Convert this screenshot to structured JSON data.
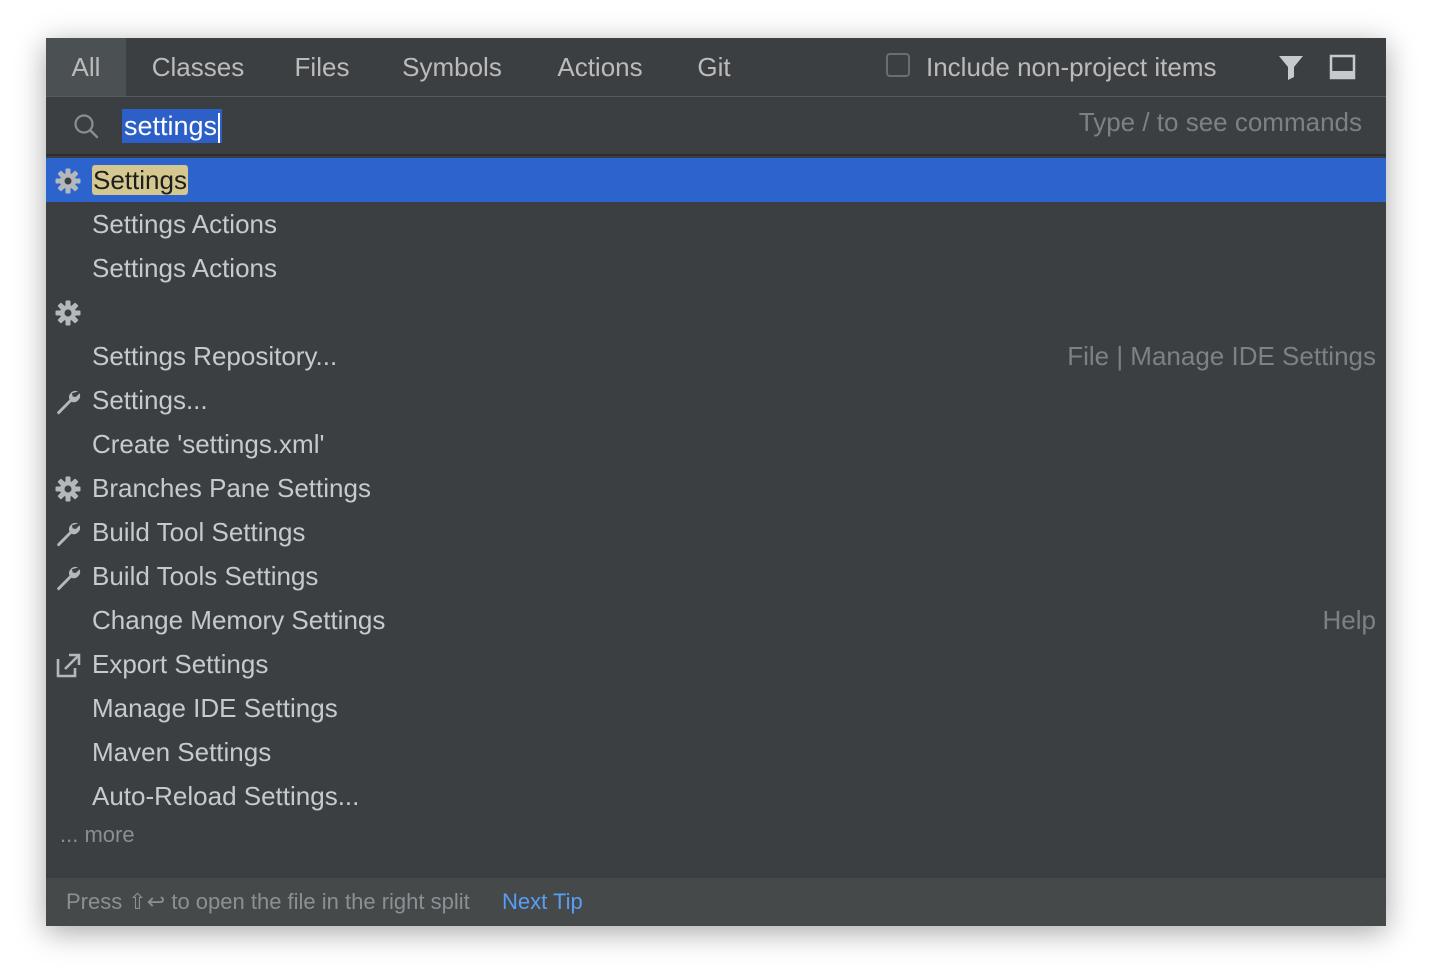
{
  "tabs": [
    {
      "label": "All",
      "active": true
    },
    {
      "label": "Classes",
      "active": false
    },
    {
      "label": "Files",
      "active": false
    },
    {
      "label": "Symbols",
      "active": false
    },
    {
      "label": "Actions",
      "active": false
    },
    {
      "label": "Git",
      "active": false
    }
  ],
  "options": {
    "include_label": "Include non-project items",
    "include_checked": false,
    "filter_icon": "filter-icon",
    "preview_icon": "preview-panel-icon"
  },
  "search": {
    "icon": "search-icon",
    "query": "settings",
    "hint": "Type / to see commands"
  },
  "results": [
    {
      "icon": "gear-icon",
      "label": "Settings",
      "location": "",
      "selected": true
    },
    {
      "icon": "",
      "label": "Settings Actions",
      "location": ""
    },
    {
      "icon": "",
      "label": "Settings Actions",
      "location": ""
    },
    {
      "icon": "gear-icon",
      "label": "",
      "location": ""
    },
    {
      "icon": "",
      "label": "Settings Repository...",
      "location": "File | Manage IDE Settings"
    },
    {
      "icon": "wrench-icon",
      "label": "Settings...",
      "location": ""
    },
    {
      "icon": "",
      "label": "Create 'settings.xml'",
      "location": ""
    },
    {
      "icon": "gear-icon",
      "label": "Branches Pane Settings",
      "location": ""
    },
    {
      "icon": "wrench-icon",
      "label": "Build Tool Settings",
      "location": ""
    },
    {
      "icon": "wrench-icon",
      "label": "Build Tools Settings",
      "location": ""
    },
    {
      "icon": "",
      "label": "Change Memory Settings",
      "location": "Help"
    },
    {
      "icon": "export-icon",
      "label": "Export Settings",
      "location": ""
    },
    {
      "icon": "",
      "label": "Manage IDE Settings",
      "location": ""
    },
    {
      "icon": "",
      "label": "Maven Settings",
      "location": ""
    },
    {
      "icon": "",
      "label": "Auto-Reload Settings...",
      "location": ""
    }
  ],
  "more_label": "... more",
  "footer": {
    "tip": "Press ⇧↩ to open the file in the right split",
    "next_tip": "Next Tip"
  },
  "colors": {
    "background": "#3c3f41",
    "selection": "#2d63cc",
    "match_highlight": "#d4c890",
    "link": "#589df6"
  }
}
